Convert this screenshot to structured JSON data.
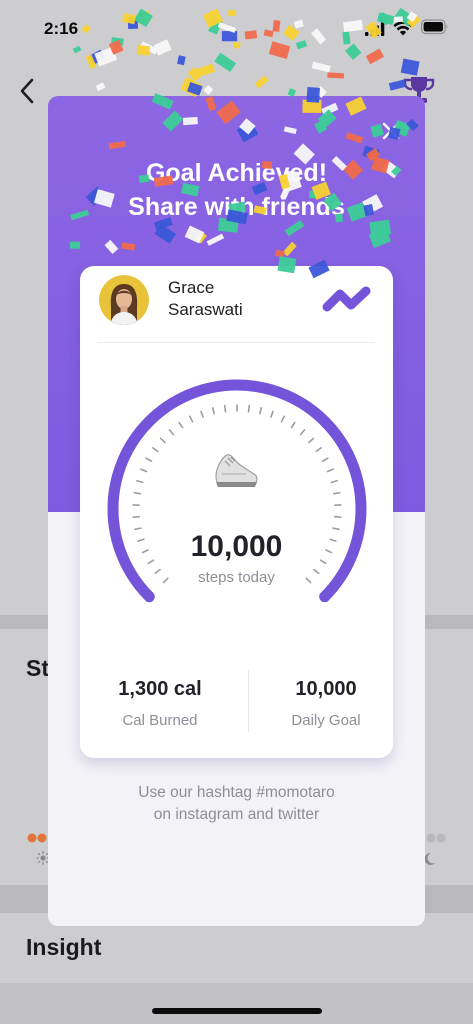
{
  "status_bar": {
    "time": "2:16"
  },
  "background": {
    "stats_heading": "St",
    "insight_heading": "Insight"
  },
  "modal": {
    "title_line1": "Goal Achieved!",
    "title_line2": "Share with friends",
    "user": {
      "name_line1": "Grace",
      "name_line2": "Saraswati"
    },
    "steps": {
      "value": "10,000",
      "label": "steps today"
    },
    "calories": {
      "value": "1,300 cal",
      "label": "Cal Burned"
    },
    "daily_goal": {
      "value": "10,000",
      "label": "Daily Goal"
    },
    "hashtag_line1": "Use our hashtag #momotaro",
    "hashtag_line2": "on instagram and twitter"
  },
  "icons": {
    "back": "chevron-left-icon",
    "trophy": "trophy-icon",
    "close": "close-icon",
    "shoe": "shoe-icon",
    "brand": "momotaro-logo"
  },
  "colors": {
    "header_purple": "#7d5bdf",
    "gauge_purple": "#7454d9",
    "background_gray": "#cdcdd0",
    "trophy_purple": "#5a38a0",
    "confetti": [
      "#f7d132",
      "#f06a4c",
      "#3b57d8",
      "#3ccc98",
      "#f8f8f8"
    ]
  },
  "progress": {
    "steps_fraction_of_goal": 1.0
  }
}
